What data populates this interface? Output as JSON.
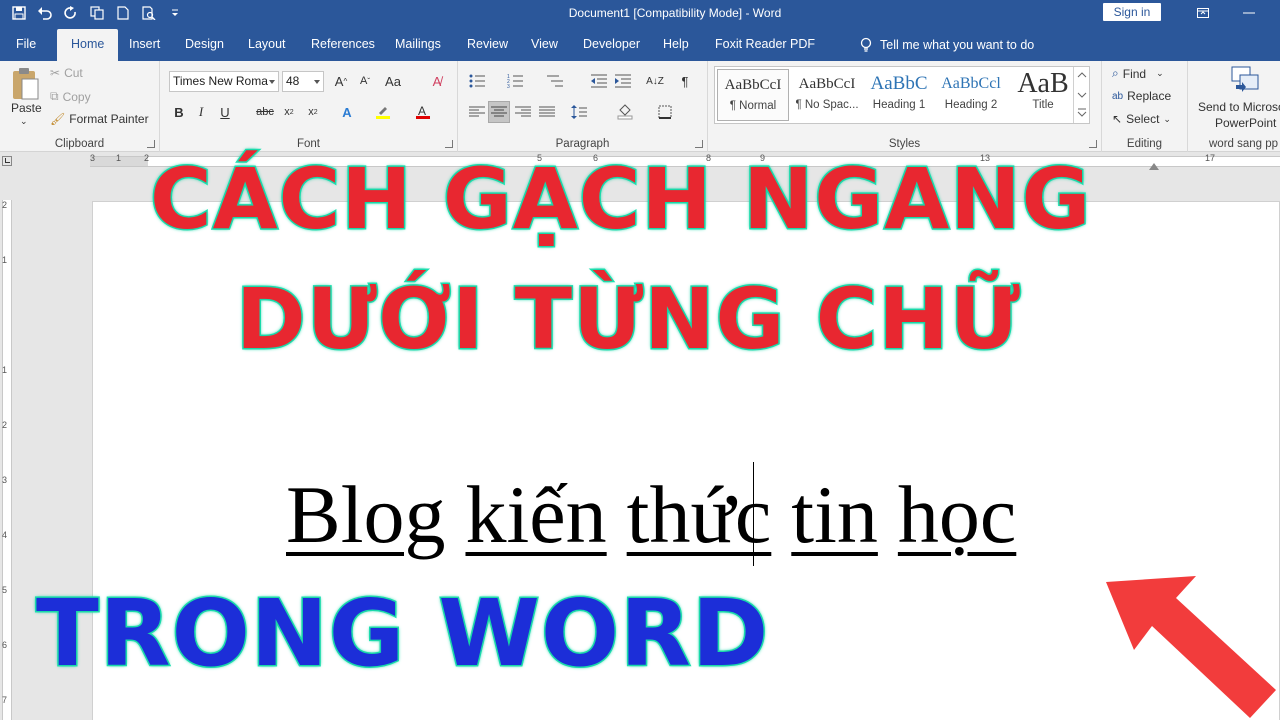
{
  "titlebar": {
    "title": "Document1 [Compatibility Mode]  -  Word",
    "sign_in": "Sign in"
  },
  "tabs": [
    "File",
    "Home",
    "Insert",
    "Design",
    "Layout",
    "References",
    "Mailings",
    "Review",
    "View",
    "Developer",
    "Help",
    "Foxit Reader PDF"
  ],
  "tell_me": "Tell me what you want to do",
  "clipboard": {
    "paste": "Paste",
    "cut": "Cut",
    "copy": "Copy",
    "format_painter": "Format Painter",
    "label": "Clipboard"
  },
  "font": {
    "name": "Times New Roma",
    "size": "48",
    "label": "Font"
  },
  "paragraph": {
    "label": "Paragraph"
  },
  "styles": {
    "items": [
      {
        "sample": "AaBbCcI",
        "name": "¶ Normal"
      },
      {
        "sample": "AaBbCcI",
        "name": "¶ No Spac..."
      },
      {
        "sample": "AaBbC",
        "name": "Heading 1"
      },
      {
        "sample": "AaBbCcl",
        "name": "Heading 2"
      },
      {
        "sample": "AaB",
        "name": "Title"
      }
    ],
    "label": "Styles"
  },
  "editing": {
    "find": "Find",
    "replace": "Replace",
    "select": "Select",
    "label": "Editing"
  },
  "send_ppt": {
    "line1": "Send to Microso",
    "line2": "PowerPoint",
    "label": "word sang pp"
  },
  "ruler": {
    "h": [
      "3",
      "1",
      "2",
      "5",
      "6",
      "8",
      "9",
      "13",
      "17"
    ],
    "v": [
      "2",
      "1",
      "1",
      "2",
      "3",
      "4",
      "5",
      "6",
      "7"
    ]
  },
  "document": {
    "words": [
      "Blog",
      "kiến",
      "thức",
      "tin",
      "học"
    ]
  },
  "overlay": {
    "line1": "CÁCH GẠCH NGANG",
    "line2": "DƯỚI TỪNG CHỮ",
    "line3": "TRONG WORD"
  },
  "colors": {
    "word_blue": "#2b579a",
    "overlay_red": "#e82730",
    "overlay_blue": "#1c2ed8",
    "overlay_outline": "#1de0b0",
    "arrow_red": "#f23c3c"
  }
}
